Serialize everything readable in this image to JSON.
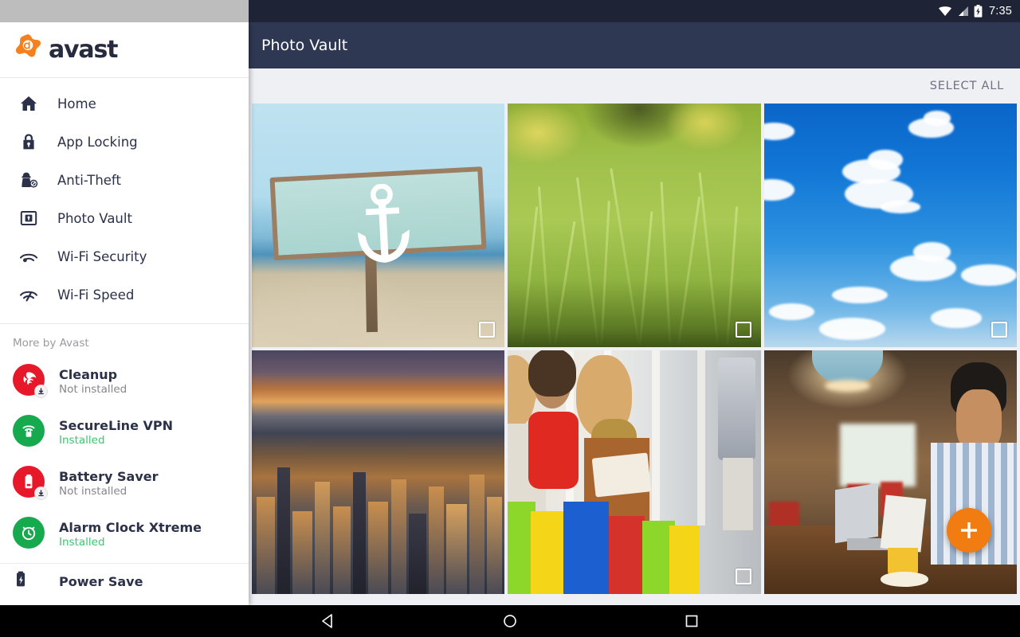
{
  "statusbar": {
    "time": "7:35",
    "icons": [
      "wifi-icon",
      "signal-icon",
      "battery-charging-icon"
    ]
  },
  "sidebar": {
    "brand": {
      "name": "avast",
      "logo_color": "#f4811f",
      "word_color": "#262b3d"
    },
    "nav_items": [
      {
        "label": "Home",
        "icon": "home-icon"
      },
      {
        "label": "App Locking",
        "icon": "lock-icon"
      },
      {
        "label": "Anti-Theft",
        "icon": "thief-blocked-icon"
      },
      {
        "label": "Photo Vault",
        "icon": "safe-icon"
      },
      {
        "label": "Wi-Fi Security",
        "icon": "wifi-shield-icon"
      },
      {
        "label": "Wi-Fi Speed",
        "icon": "wifi-speed-icon"
      }
    ],
    "more_section_title": "More by Avast",
    "more_apps": [
      {
        "name": "Cleanup",
        "status": "Not installed",
        "installed": false,
        "icon": "cleanup-icon",
        "color": "#e8182b"
      },
      {
        "name": "SecureLine VPN",
        "status": "Installed",
        "installed": true,
        "icon": "vpn-lock-icon",
        "color": "#16a94d"
      },
      {
        "name": "Battery Saver",
        "status": "Not installed",
        "installed": false,
        "icon": "battery-icon",
        "color": "#e8182b"
      },
      {
        "name": "Alarm Clock Xtreme",
        "status": "Installed",
        "installed": true,
        "icon": "alarm-clock-icon",
        "color": "#16a94d"
      },
      {
        "name": "Power Save",
        "status": "",
        "installed": false,
        "icon": "power-save-icon",
        "color": "#2b3148"
      }
    ]
  },
  "appbar": {
    "title": "Photo Vault"
  },
  "toolbar": {
    "select_all_label": "SELECT ALL"
  },
  "gallery": {
    "photos": [
      {
        "alt": "Beach sign with anchor",
        "checked": false,
        "checkbox_name": "photo-checkbox"
      },
      {
        "alt": "Green grass macro",
        "checked": false,
        "checkbox_name": "photo-checkbox"
      },
      {
        "alt": "Blue sky with clouds",
        "checked": false,
        "checkbox_name": "photo-checkbox"
      },
      {
        "alt": "Aerial city at sunset",
        "checked": false,
        "checkbox_name": "photo-checkbox"
      },
      {
        "alt": "Women shopping with bags",
        "checked": false,
        "checkbox_name": "photo-checkbox"
      },
      {
        "alt": "Man working in cafe",
        "checked": false,
        "checkbox_name": "photo-checkbox"
      }
    ],
    "fab": {
      "label": "+",
      "color": "#f07c12",
      "name": "add-photo-fab"
    }
  },
  "navbar": {
    "buttons": [
      {
        "name": "back-button",
        "icon": "triangle-left-icon"
      },
      {
        "name": "home-button",
        "icon": "circle-icon"
      },
      {
        "name": "recents-button",
        "icon": "square-icon"
      }
    ]
  },
  "colors": {
    "appbar": "#2f3853",
    "statusbar": "#1e2436",
    "content_bg": "#eff0f4",
    "accent_orange": "#f07c12",
    "installed_green": "#3ec46d"
  }
}
